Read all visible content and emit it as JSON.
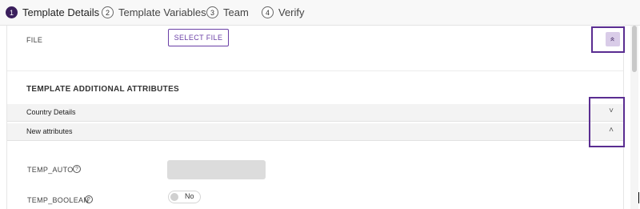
{
  "stepper": {
    "steps": [
      {
        "num": "1",
        "label": "Template Details"
      },
      {
        "num": "2",
        "label": "Template Variables"
      },
      {
        "num": "3",
        "label": "Team"
      },
      {
        "num": "4",
        "label": "Verify"
      }
    ]
  },
  "file": {
    "label": "FILE",
    "button_label": "SELECT FILE"
  },
  "section": {
    "title": "TEMPLATE ADDITIONAL ATTRIBUTES"
  },
  "accordions": [
    {
      "label": "Country Details",
      "chevron": "˅"
    },
    {
      "label": "New attributes",
      "chevron": "˄"
    }
  ],
  "fields": {
    "temp_auto": {
      "label": "TEMP_AUTO",
      "value": ""
    },
    "temp_boolean": {
      "label": "TEMP_BOOLEAN",
      "toggle_text": "No"
    }
  },
  "icons": {
    "help": "?",
    "collapse_all": "«"
  },
  "colors": {
    "accent": "#5a2d91",
    "active_step": "#3a1f5c",
    "button_text": "#6a3fa6"
  }
}
